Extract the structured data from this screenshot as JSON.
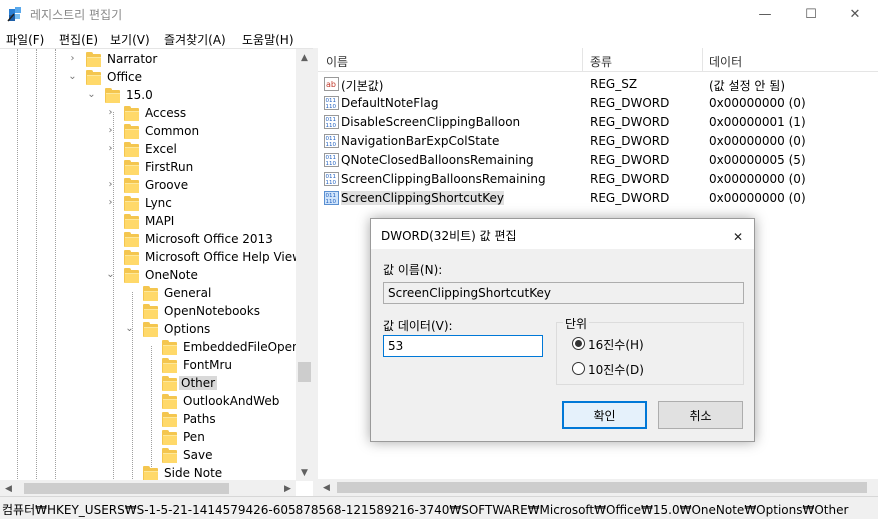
{
  "window": {
    "title": "레지스트리 편집기",
    "minimize": "—",
    "maximize": "☐",
    "close": "✕"
  },
  "menu": [
    "파일(F)",
    "편집(E)",
    "보기(V)",
    "즐겨찾기(A)",
    "도움말(H)"
  ],
  "tree": {
    "nodes": [
      {
        "label": "Narrator",
        "expander": "›"
      },
      {
        "label": "Office",
        "expander": "⌄"
      },
      {
        "label": "15.0",
        "expander": "⌄"
      },
      {
        "label": "Access",
        "expander": "›"
      },
      {
        "label": "Common",
        "expander": "›"
      },
      {
        "label": "Excel",
        "expander": "›"
      },
      {
        "label": "FirstRun",
        "expander": ""
      },
      {
        "label": "Groove",
        "expander": "›"
      },
      {
        "label": "Lync",
        "expander": "›"
      },
      {
        "label": "MAPI",
        "expander": ""
      },
      {
        "label": "Microsoft Office 2013",
        "expander": ""
      },
      {
        "label": "Microsoft Office Help Viewer",
        "expander": ""
      },
      {
        "label": "OneNote",
        "expander": "⌄"
      },
      {
        "label": "General",
        "expander": ""
      },
      {
        "label": "OpenNotebooks",
        "expander": ""
      },
      {
        "label": "Options",
        "expander": "⌄"
      },
      {
        "label": "EmbeddedFileOpenConfirmation",
        "expander": ""
      },
      {
        "label": "FontMru",
        "expander": ""
      },
      {
        "label": "Other",
        "expander": ""
      },
      {
        "label": "OutlookAndWeb",
        "expander": ""
      },
      {
        "label": "Paths",
        "expander": ""
      },
      {
        "label": "Pen",
        "expander": ""
      },
      {
        "label": "Save",
        "expander": ""
      },
      {
        "label": "Side Note",
        "expander": ""
      }
    ],
    "selected": "Other"
  },
  "list": {
    "headers": {
      "name": "이름",
      "type": "종류",
      "data": "데이터"
    },
    "rows": [
      {
        "icon": "string-value-icon",
        "name": "(기본값)",
        "type": "REG_SZ",
        "data": "(값 설정 안 됨)"
      },
      {
        "icon": "binary-value-icon",
        "name": "DefaultNoteFlag",
        "type": "REG_DWORD",
        "data": "0x00000000 (0)"
      },
      {
        "icon": "binary-value-icon",
        "name": "DisableScreenClippingBalloon",
        "type": "REG_DWORD",
        "data": "0x00000001 (1)"
      },
      {
        "icon": "binary-value-icon",
        "name": "NavigationBarExpColState",
        "type": "REG_DWORD",
        "data": "0x00000000 (0)"
      },
      {
        "icon": "binary-value-icon",
        "name": "QNoteClosedBalloonsRemaining",
        "type": "REG_DWORD",
        "data": "0x00000005 (5)"
      },
      {
        "icon": "binary-value-icon",
        "name": "ScreenClippingBalloonsRemaining",
        "type": "REG_DWORD",
        "data": "0x00000000 (0)"
      },
      {
        "icon": "binary-value-icon",
        "name": "ScreenClippingShortcutKey",
        "type": "REG_DWORD",
        "data": "0x00000000 (0)"
      }
    ]
  },
  "status": "컴퓨터₩HKEY_USERS₩S-1-5-21-1414579426-605878568-121589216-3740₩SOFTWARE₩Microsoft₩Office₩15.0₩OneNote₩Options₩Other",
  "dialog": {
    "title": "DWORD(32비트) 값 편집",
    "value_name_label": "값 이름(N):",
    "value_name": "ScreenClippingShortcutKey",
    "value_data_label": "값 데이터(V):",
    "value_data": "53",
    "base_label": "단위",
    "hex_label": "16진수(H)",
    "dec_label": "10진수(D)",
    "base_selected": "hex",
    "ok_label": "확인",
    "cancel_label": "취소"
  },
  "colors": {
    "folder": "#f4c64f",
    "accent": "#0078d7",
    "selection": "#d9d9d9"
  }
}
